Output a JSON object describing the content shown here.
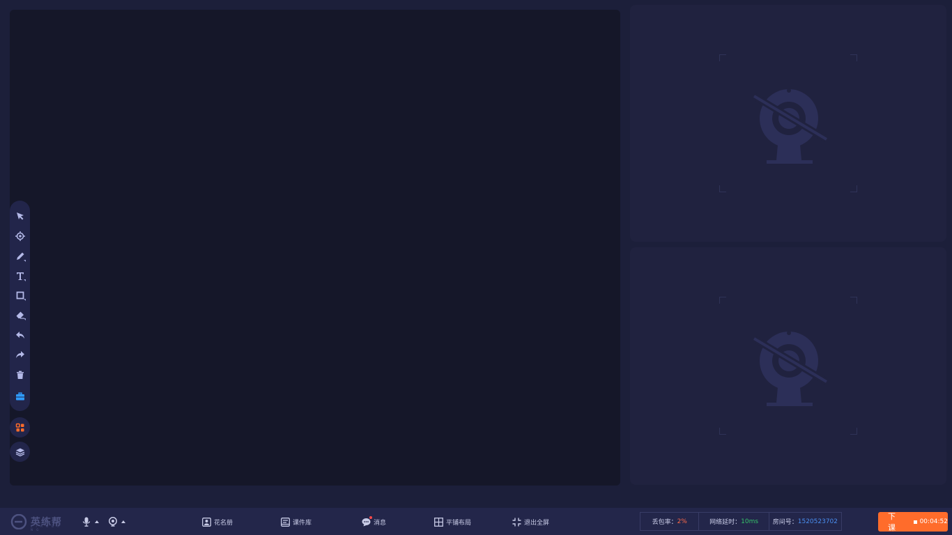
{
  "toolbar": {
    "tools": [
      {
        "name": "select-icon",
        "has_submenu": false,
        "active": false
      },
      {
        "name": "laser-pointer-icon",
        "has_submenu": false,
        "active": false
      },
      {
        "name": "pen-icon",
        "has_submenu": true,
        "active": false
      },
      {
        "name": "text-icon",
        "has_submenu": true,
        "active": false
      },
      {
        "name": "shape-icon",
        "has_submenu": true,
        "active": false
      },
      {
        "name": "eraser-icon",
        "has_submenu": true,
        "active": false
      },
      {
        "name": "undo-icon",
        "has_submenu": false,
        "active": false
      },
      {
        "name": "redo-icon",
        "has_submenu": false,
        "active": false
      },
      {
        "name": "clear-icon",
        "has_submenu": false,
        "active": false
      },
      {
        "name": "toolbox-icon",
        "has_submenu": false,
        "active": true
      }
    ],
    "extra_buttons": [
      "apps-grid-icon",
      "layers-icon"
    ]
  },
  "video_panels": [
    {
      "state": "camera-off",
      "icon": "camera-off-icon"
    },
    {
      "state": "camera-off",
      "icon": "camera-off-icon"
    }
  ],
  "bottom_bar": {
    "logo_text": "英练帮",
    "logo_subtext": "L I A N B A N G",
    "devices": [
      {
        "name": "microphone-icon"
      },
      {
        "name": "camera-icon"
      }
    ],
    "nav": {
      "roster": "花名册",
      "courseware": "课件库",
      "messages": "消息",
      "tile_layout": "平铺布局",
      "exit_fullscreen": "退出全屏"
    },
    "stats": {
      "packet_loss_label": "丢包率：",
      "packet_loss_value": "2%",
      "latency_label": "网络延时：",
      "latency_value": "10ms",
      "room_label": "房间号：",
      "room_value": "1520523702"
    },
    "end_class": {
      "label": "下课",
      "timer": "00:04:52"
    }
  },
  "colors": {
    "accent_orange": "#ff6c2b",
    "active_tool": "#2f9bff",
    "apps_icon": "#ff6c2b",
    "stat_red": "#ff6a4a",
    "stat_green": "#36c26a",
    "stat_blue": "#4a8ef0"
  }
}
